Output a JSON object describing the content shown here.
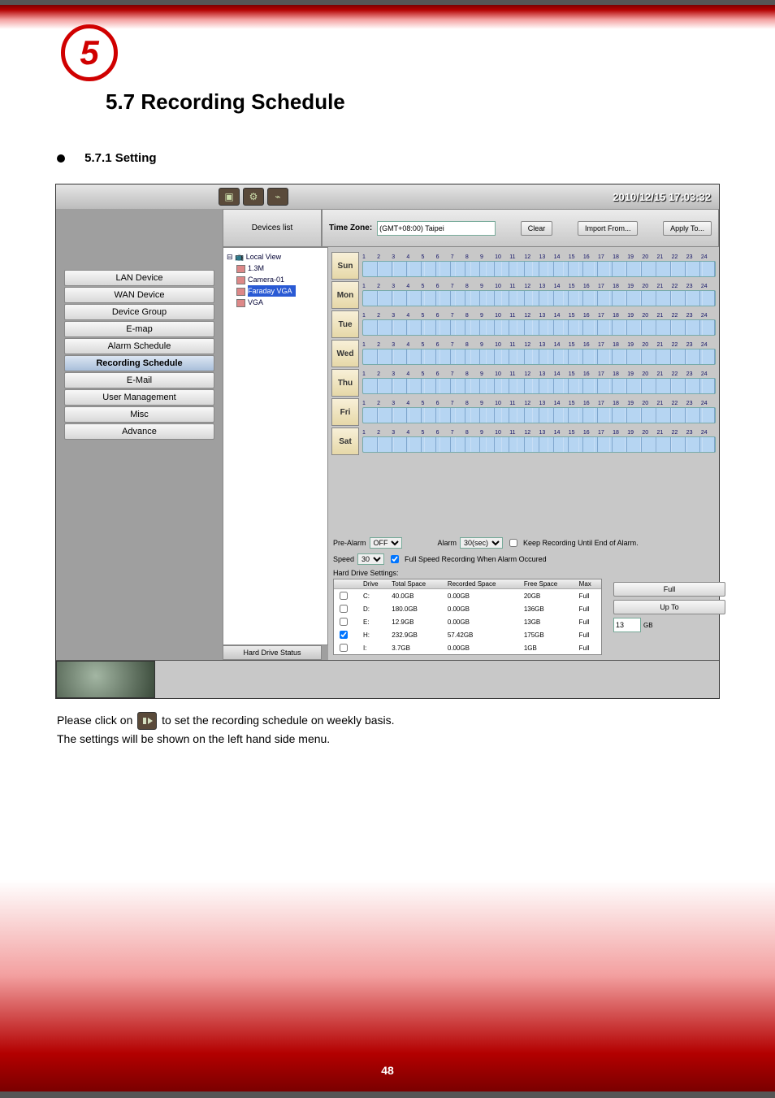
{
  "page_number": "48",
  "chapter_badge": "5",
  "heading_a": "5.7 ",
  "heading_b": "Recording Schedule",
  "sub_heading": "5.7.1 Setting",
  "clock": "2010/12/15 17:03:32",
  "devices_list_label": "Devices list",
  "timezone_label": "Time Zone:",
  "timezone_value": "(GMT+08:00) Taipei",
  "btn_clear": "Clear",
  "btn_import": "Import From...",
  "btn_apply": "Apply To...",
  "nav": [
    "LAN Device",
    "WAN Device",
    "Device Group",
    "E-map",
    "Alarm Schedule",
    "Recording Schedule",
    "E-Mail",
    "User Management",
    "Misc",
    "Advance"
  ],
  "nav_selected_index": 5,
  "tree": {
    "root": "Local View",
    "items": [
      "1.3M",
      "Camera-01",
      "Faraday VGA",
      "VGA"
    ],
    "selected": "Faraday VGA"
  },
  "days": [
    "Sun",
    "Mon",
    "Tue",
    "Wed",
    "Thu",
    "Fri",
    "Sat"
  ],
  "hours": [
    "1",
    "2",
    "3",
    "4",
    "5",
    "6",
    "7",
    "8",
    "9",
    "10",
    "11",
    "12",
    "13",
    "14",
    "15",
    "16",
    "17",
    "18",
    "19",
    "20",
    "21",
    "22",
    "23",
    "24"
  ],
  "settings": {
    "prealarm_label": "Pre-Alarm",
    "prealarm_value": "OFF",
    "alarm_label": "Alarm",
    "alarm_value": "30(sec)",
    "keep_rec_label": "Keep Recording Until End of Alarm.",
    "speed_label": "Speed",
    "speed_value": "30",
    "full_speed_label": "Full Speed Recording When Alarm Occured"
  },
  "hd_status_label": "Hard Drive Status",
  "hd_settings_label": "Hard Drive Settings:",
  "hd_headers": [
    "",
    "Drive",
    "Total Space",
    "Recorded Space",
    "Free Space",
    "Max"
  ],
  "hd_rows": [
    {
      "chk": false,
      "drive": "C:",
      "total": "40.0GB",
      "rec": "0.00GB",
      "free": "20GB",
      "max": "Full"
    },
    {
      "chk": false,
      "drive": "D:",
      "total": "180.0GB",
      "rec": "0.00GB",
      "free": "136GB",
      "max": "Full"
    },
    {
      "chk": false,
      "drive": "E:",
      "total": "12.9GB",
      "rec": "0.00GB",
      "free": "13GB",
      "max": "Full"
    },
    {
      "chk": true,
      "drive": "H:",
      "total": "232.9GB",
      "rec": "57.42GB",
      "free": "175GB",
      "max": "Full"
    },
    {
      "chk": false,
      "drive": "I:",
      "total": "3.7GB",
      "rec": "0.00GB",
      "free": "1GB",
      "max": "Full"
    }
  ],
  "hd_right": {
    "full": "Full",
    "upto": "Up To",
    "gb_value": "13",
    "gb_unit": "GB"
  },
  "below_a": "Please click on ",
  "below_b": " to set the recording schedule on weekly basis.",
  "below_c": "The settings will be shown on the left hand side menu."
}
